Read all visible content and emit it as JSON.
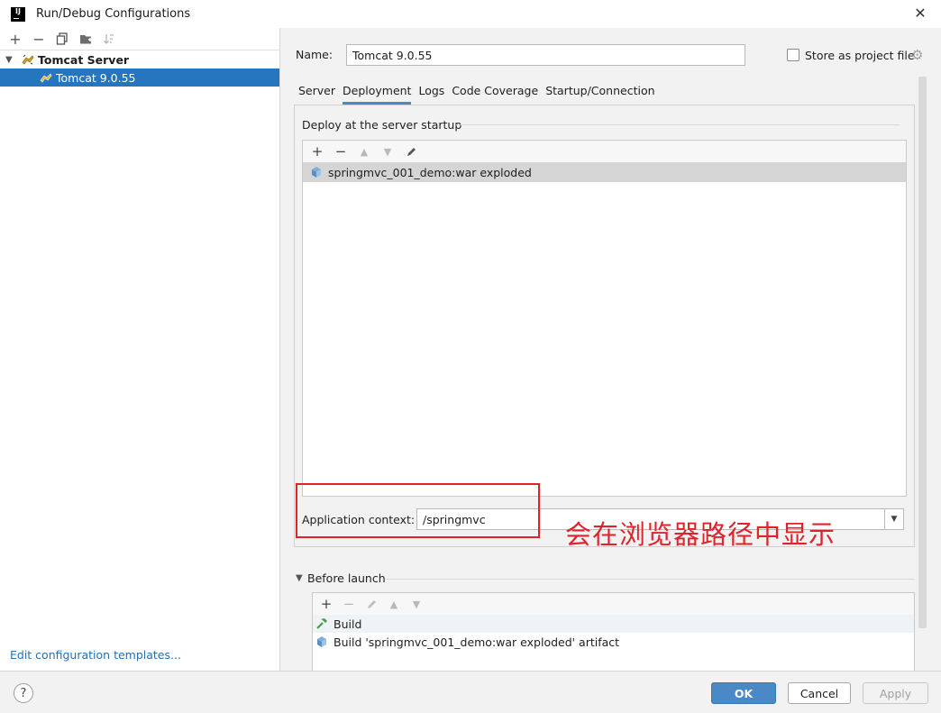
{
  "window": {
    "title": "Run/Debug Configurations",
    "logo_text": "IJ",
    "close_glyph": "✕"
  },
  "left": {
    "toolbar": [
      {
        "name": "add-button",
        "glyph": "+",
        "enabled": true
      },
      {
        "name": "remove-button",
        "glyph": "−",
        "enabled": true
      },
      {
        "name": "copy-button",
        "glyph": "⧉",
        "enabled": true
      },
      {
        "name": "folder-button",
        "glyph": "▆",
        "enabled": true
      },
      {
        "name": "sort-button",
        "glyph": "⇅",
        "enabled": false
      }
    ],
    "tree": {
      "group": "Tomcat Server",
      "item": "Tomcat 9.0.55"
    },
    "edit_templates": "Edit configuration templates..."
  },
  "config": {
    "name_label": "Name:",
    "name_value": "Tomcat 9.0.55",
    "store_label": "Store as project file",
    "store_checked": false
  },
  "tabs": [
    {
      "label": "Server",
      "active": false
    },
    {
      "label": "Deployment",
      "active": true
    },
    {
      "label": "Logs",
      "active": false
    },
    {
      "label": "Code Coverage",
      "active": false
    },
    {
      "label": "Startup/Connection",
      "active": false
    }
  ],
  "deployment": {
    "section_title": "Deploy at the server startup",
    "artifact": "springmvc_001_demo:war exploded",
    "context_label": "Application context:",
    "context_value": "/springmvc"
  },
  "annotation": "会在浏览器路径中显示",
  "before_launch": {
    "title": "Before launch",
    "items": [
      {
        "label": "Build",
        "icon": "hammer-icon"
      },
      {
        "label": "Build 'springmvc_001_demo:war exploded' artifact",
        "icon": "artifact-icon"
      }
    ]
  },
  "buttons": {
    "help": "?",
    "ok": "OK",
    "cancel": "Cancel",
    "apply": "Apply"
  },
  "colors": {
    "selection": "#2675bf",
    "primary_button": "#4a88c7",
    "annotation_red": "#e0232b",
    "link": "#2470b3"
  }
}
